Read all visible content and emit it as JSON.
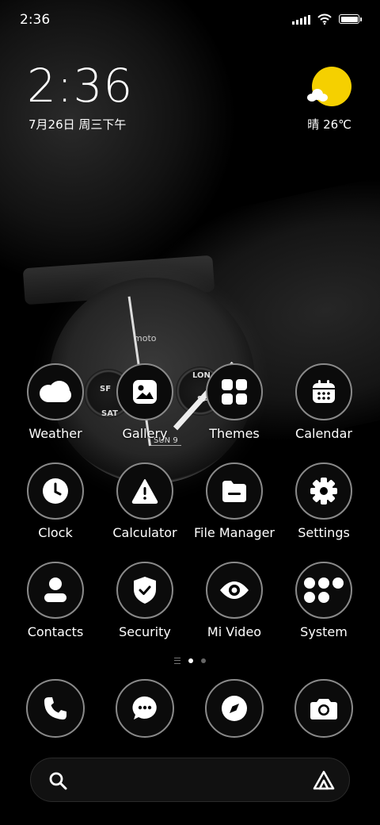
{
  "status_bar": {
    "time": "2:36"
  },
  "clock_widget": {
    "time": "2:36",
    "date": "7月26日 周三下午"
  },
  "weather_widget": {
    "text": "晴 26℃",
    "sun_color": "#f5d000"
  },
  "wallpaper_text": {
    "brand": "moto",
    "sub1": "SF",
    "sub2": "SAT",
    "sub3": "LON",
    "sub4": "SA",
    "date": "SUN 9"
  },
  "apps": [
    {
      "label": "Weather",
      "icon": "cloud-icon"
    },
    {
      "label": "Gallery",
      "icon": "image-icon"
    },
    {
      "label": "Themes",
      "icon": "grid-icon"
    },
    {
      "label": "Calendar",
      "icon": "calendar-icon"
    },
    {
      "label": "Clock",
      "icon": "clock-icon"
    },
    {
      "label": "Calculator",
      "icon": "warning-triangle-icon"
    },
    {
      "label": "File Manager",
      "icon": "folder-icon"
    },
    {
      "label": "Settings",
      "icon": "gear-icon"
    },
    {
      "label": "Contacts",
      "icon": "person-icon"
    },
    {
      "label": "Security",
      "icon": "shield-check-icon"
    },
    {
      "label": "Mi Video",
      "icon": "eye-icon"
    },
    {
      "label": "System",
      "icon": "folder-grid-icon"
    }
  ],
  "pager": {
    "pages": 2,
    "active": 1
  },
  "dock": [
    {
      "name": "phone",
      "icon": "phone-icon"
    },
    {
      "name": "messages",
      "icon": "chat-icon"
    },
    {
      "name": "browser",
      "icon": "compass-icon"
    },
    {
      "name": "camera",
      "icon": "camera-icon"
    }
  ],
  "search_bar": {
    "left_icon": "search-icon",
    "right_icon": "assistant-icon"
  },
  "colors": {
    "icon_ring": "#8a8a8a",
    "accent_sun": "#f5d000"
  }
}
